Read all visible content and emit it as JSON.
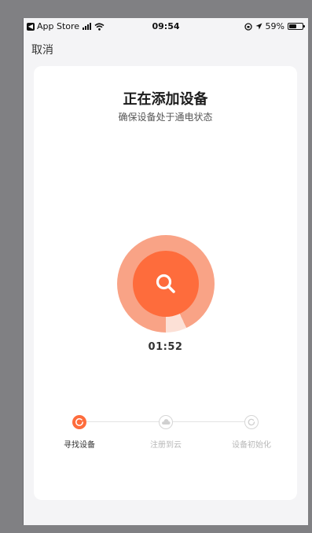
{
  "status_bar": {
    "back_app": "App Store",
    "time": "09:54",
    "battery_percent": "59%",
    "battery_level": 0.59
  },
  "nav": {
    "cancel_label": "取消"
  },
  "main": {
    "title": "正在添加设备",
    "subtitle": "确保设备处于通电状态",
    "timer": "01:52",
    "search_progress": 0.93
  },
  "steps": [
    {
      "label": "寻找设备",
      "state": "active"
    },
    {
      "label": "注册到云",
      "state": "pending"
    },
    {
      "label": "设备初始化",
      "state": "pending"
    }
  ],
  "colors": {
    "accent": "#fe6c3c",
    "ring": "#f9a386",
    "ring_track": "#fce0d6",
    "frame": "#808083"
  }
}
